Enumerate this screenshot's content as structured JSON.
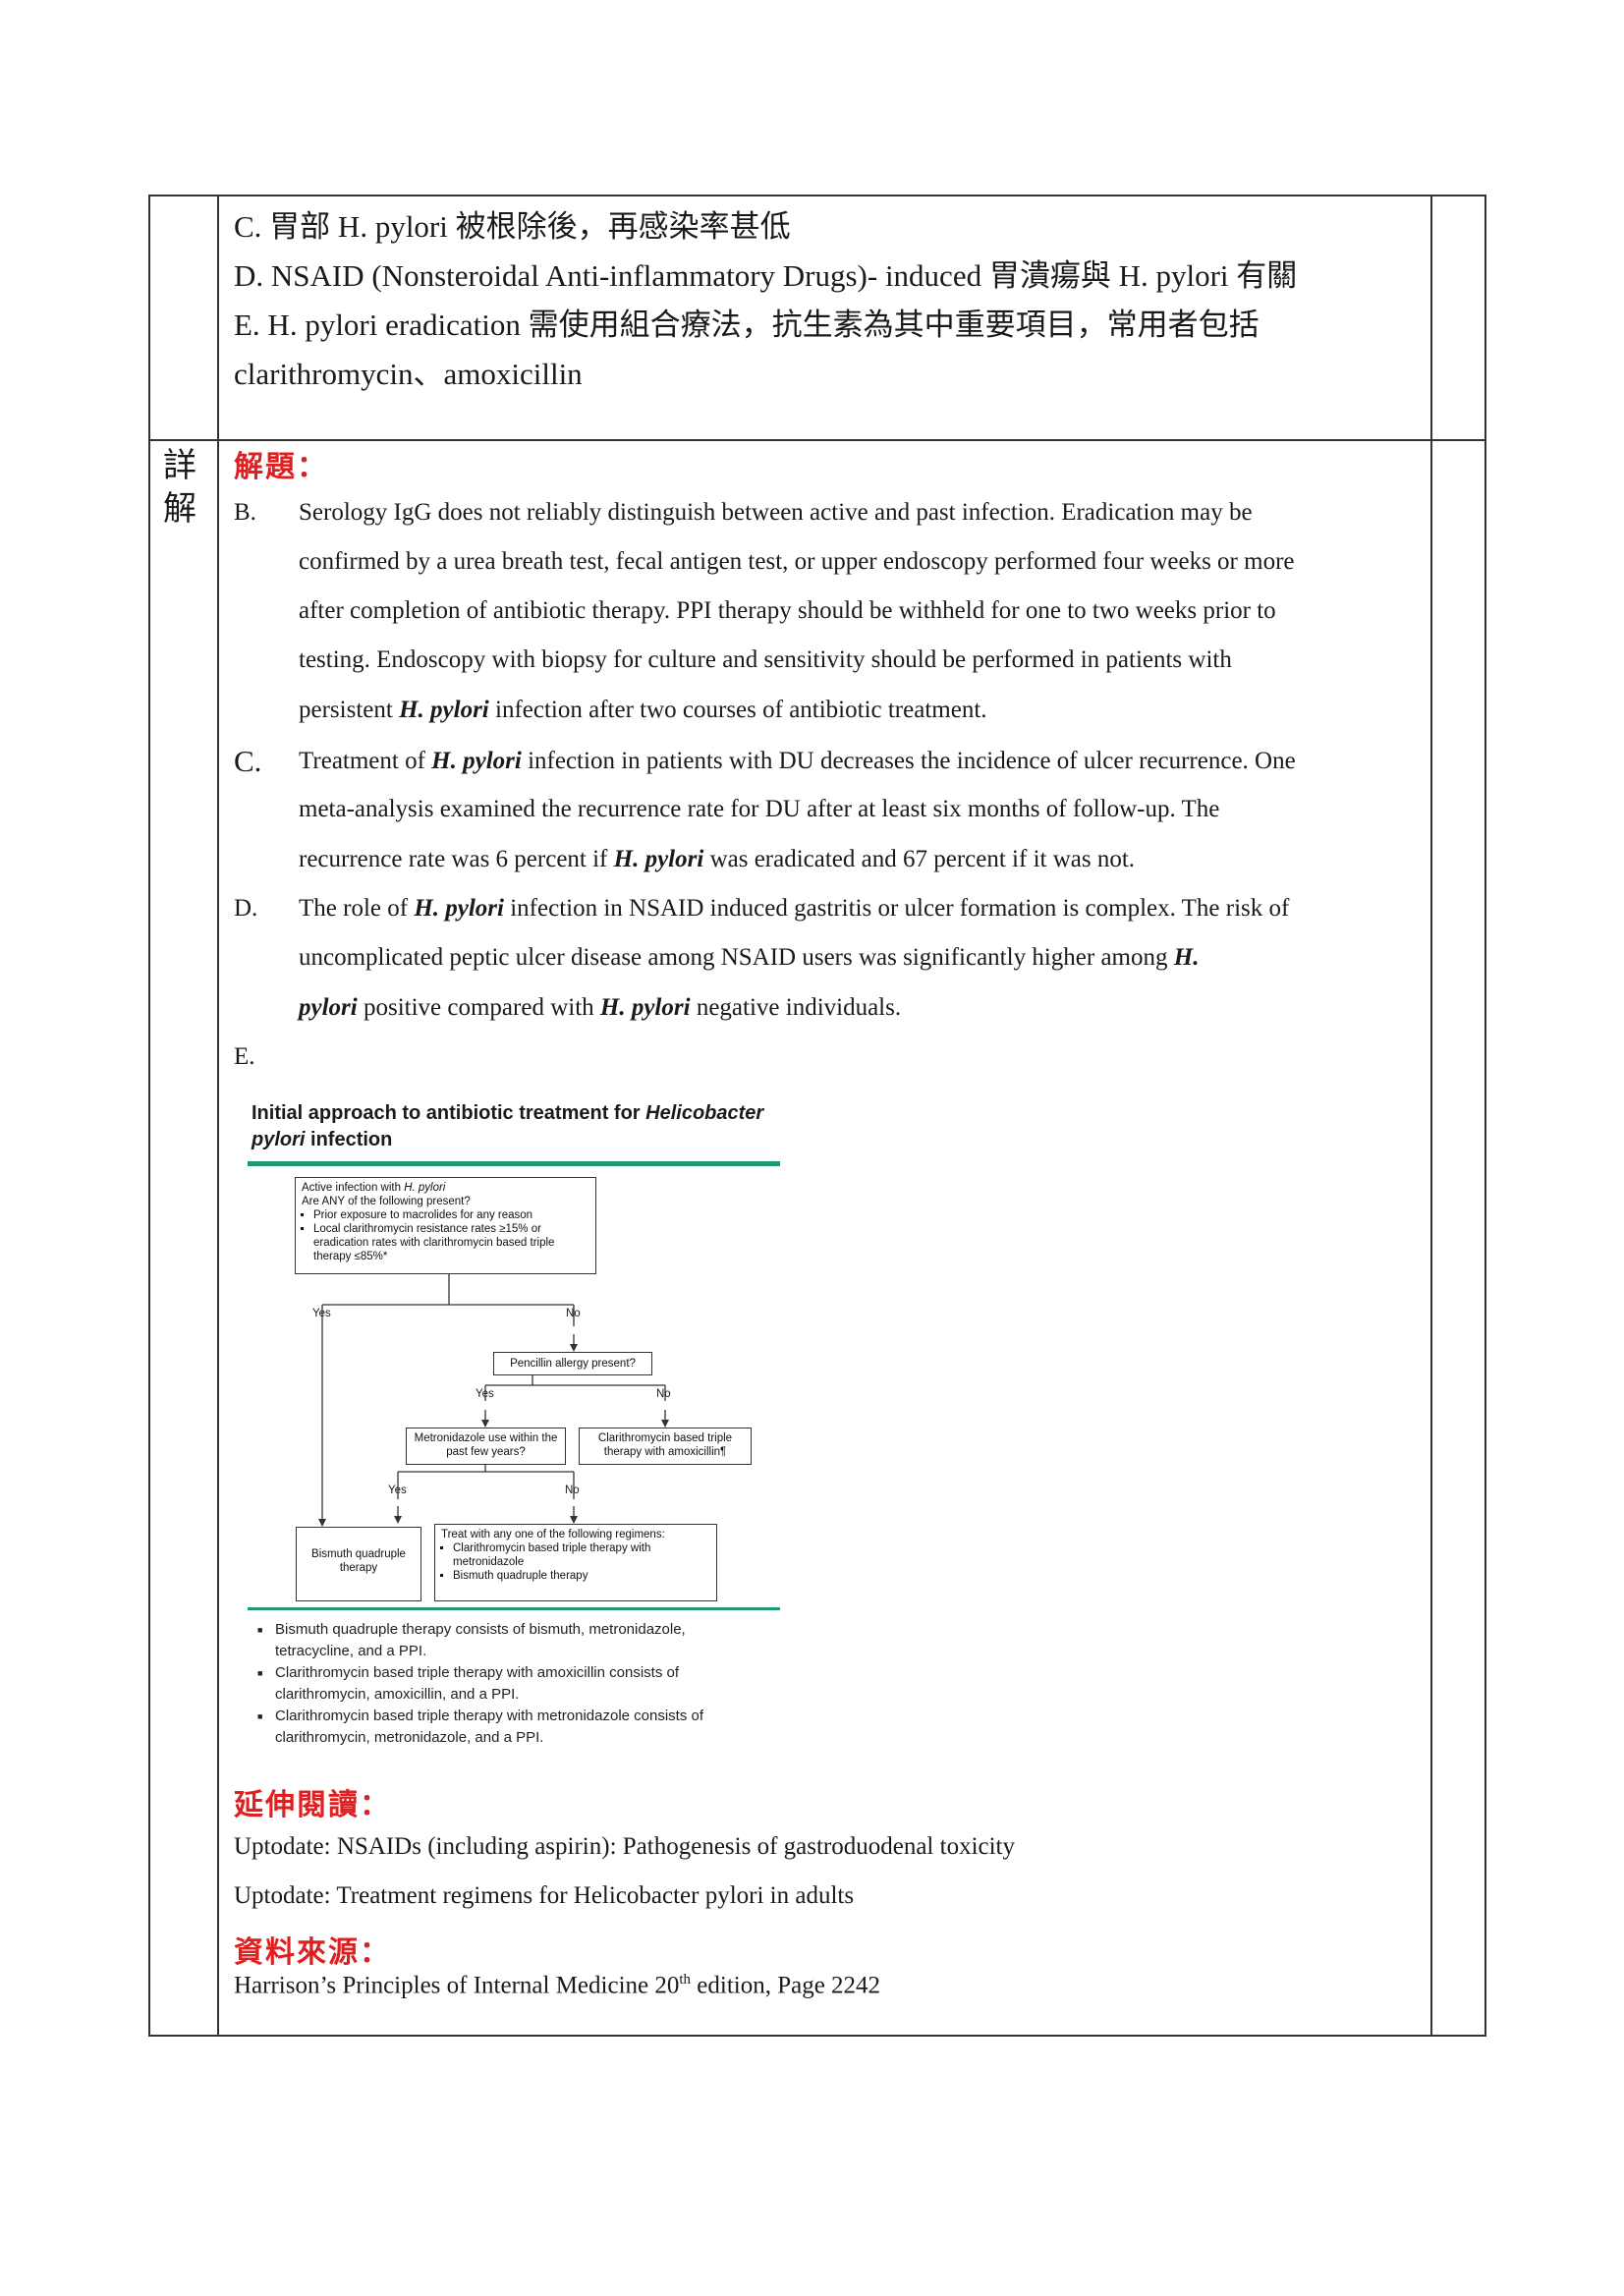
{
  "options": {
    "c": "C. 胃部 H. pylori 被根除後，再感染率甚低",
    "d": "D. NSAID (Nonsteroidal Anti-inflammatory Drugs)- induced 胃潰瘍與 H. pylori 有關",
    "e_line1": "E. H. pylori eradication 需使用組合療法，抗生素為其中重要項目，常用者包括",
    "e_line2": "clarithromycin、amoxicillin"
  },
  "side_label": {
    "char1": "詳",
    "char2": "解"
  },
  "solution": {
    "heading": "解題：",
    "b_letter": "B.",
    "b_lines": [
      "Serology IgG does not reliably distinguish between active and past infection. Eradication may be",
      "confirmed by a urea breath test, fecal antigen test, or upper endoscopy performed four weeks or more",
      "after completion of antibiotic therapy. PPI therapy should be withheld for one to two weeks prior to",
      "testing. Endoscopy with biopsy for culture and sensitivity should be performed in patients with"
    ],
    "b_last_pre": "persistent ",
    "b_last_hp": "H. pylori",
    "b_last_post": " infection after two courses of antibiotic treatment.",
    "c_letter": "C.",
    "c1_pre": "Treatment of ",
    "c1_hp": "H. pylori",
    "c1_post": " infection in patients with DU decreases the incidence of ulcer recurrence. One",
    "c2": "meta-analysis examined the recurrence rate for DU after at least six months of follow-up. The",
    "c3_pre": "recurrence rate was 6 percent if ",
    "c3_hp": "H. pylori",
    "c3_post": " was eradicated and 67 percent if it was not.",
    "d_letter": "D.",
    "d1_pre": "The role of ",
    "d1_hp": "H. pylori",
    "d1_post": " infection in NSAID induced gastritis or ulcer formation is complex. The risk of",
    "d2_pre": "uncomplicated peptic ulcer disease among NSAID users was significantly higher among ",
    "d2_hp": "H.",
    "d3_hp": "pylori",
    "d3_mid": " positive compared with ",
    "d3_hp2": "H. pylori",
    "d3_post": " negative individuals.",
    "e_letter": "E."
  },
  "figure": {
    "title_pre": "Initial approach to antibiotic treatment for ",
    "title_italic": "Helicobacter pylori",
    "title_post": " infection",
    "box1_l1_pre": "Active infection with ",
    "box1_l1_it": "H. pylori",
    "box1_l2": "Are ANY of the following present?",
    "box1_items": [
      "Prior exposure to macrolides for any reason",
      "Local clarithromycin resistance rates ≥15% or eradication rates with clarithromycin based triple therapy ≤85%*"
    ],
    "yes": "Yes",
    "no": "No",
    "box2": "Pencillin allergy present?",
    "box3": "Metronidazole use within the past few years?",
    "box4": "Clarithromycin based triple therapy with amoxicillin¶",
    "box5": "Bismuth quadruple therapy",
    "box6_head": "Treat with any one of the following regimens:",
    "box6_items": [
      "Clarithromycin based triple therapy with metronidazole",
      "Bismuth quadruple therapy"
    ],
    "notes": [
      "Bismuth quadruple therapy consists of bismuth, metronidazole, tetracycline, and a PPI.",
      "Clarithromycin based triple therapy with amoxicillin consists of clarithromycin, amoxicillin, and a PPI.",
      "Clarithromycin based triple therapy with metronidazole consists of clarithromycin, metronidazole, and a PPI."
    ]
  },
  "further_reading": {
    "heading": "延伸閱讀：",
    "items": [
      "Uptodate: NSAIDs (including aspirin): Pathogenesis of gastroduodenal toxicity",
      "Uptodate: Treatment regimens for Helicobacter pylori in adults"
    ]
  },
  "source": {
    "heading": "資料來源：",
    "pre": "Harrison’s Principles of Internal Medicine 20",
    "sup": "th",
    "post": " edition, Page 2242"
  },
  "colors": {
    "heading_red": "#e02020",
    "figure_bar": "#1f9a6e"
  }
}
